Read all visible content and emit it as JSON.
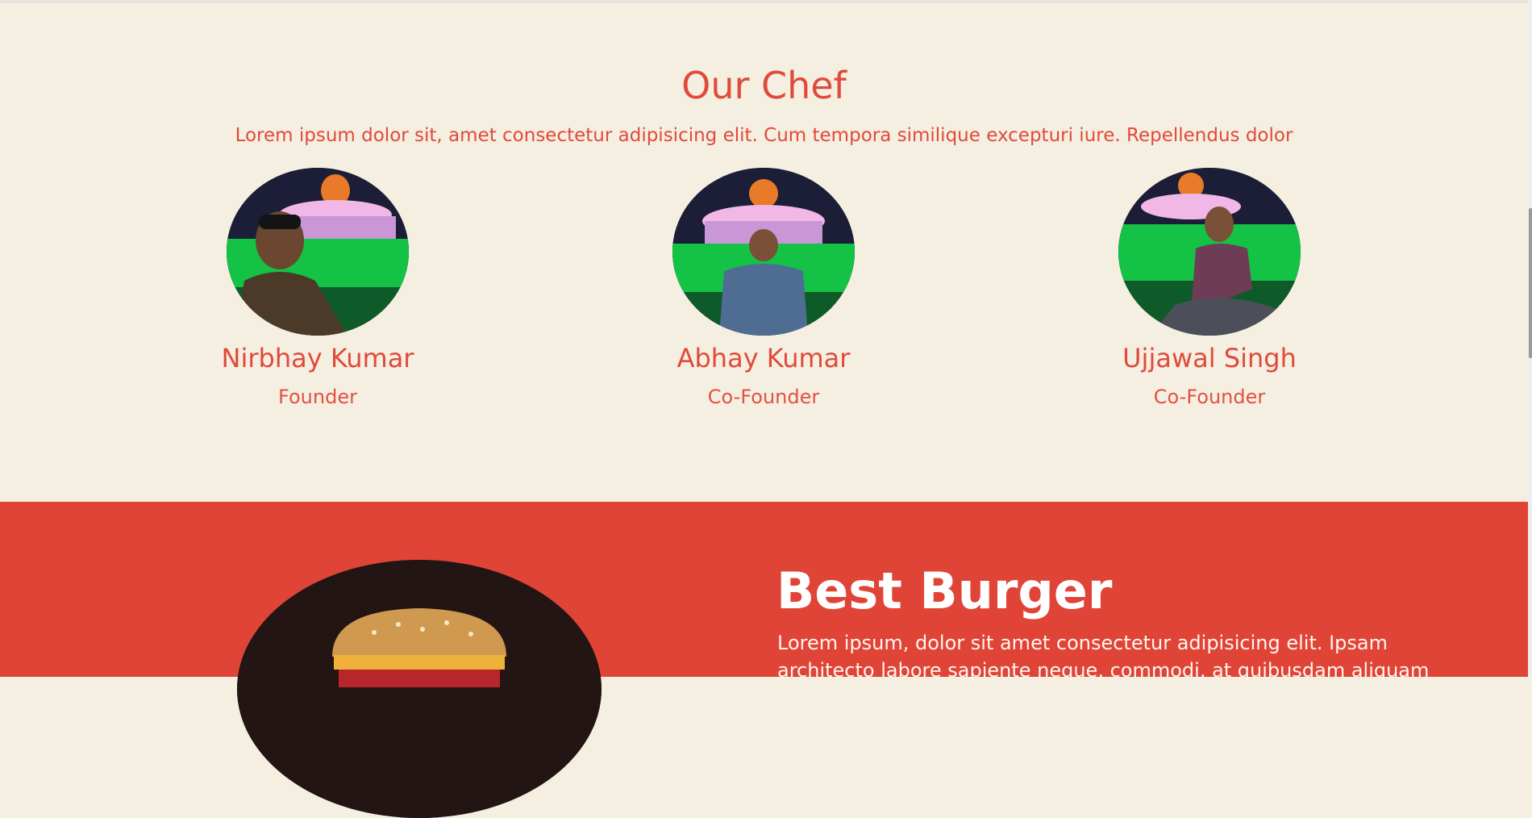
{
  "chef_section": {
    "title": "Our Chef",
    "subtitle": "Lorem ipsum dolor sit, amet consectetur adipisicing elit. Cum tempora similique excepturi iure. Repellendus dolor",
    "chefs": [
      {
        "name": "Nirbhay Kumar",
        "role": "Founder"
      },
      {
        "name": "Abhay Kumar",
        "role": "Co-Founder"
      },
      {
        "name": "Ujjawal Singh",
        "role": "Co-Founder"
      }
    ]
  },
  "burger_section": {
    "title": "Best Burger",
    "text": "Lorem ipsum, dolor sit amet consectetur adipisicing elit. Ipsam architecto labore sapiente neque, commodi, at quibusdam aliquam"
  },
  "colors": {
    "accent": "#e04a3a",
    "page_bg": "#f5efe1",
    "burger_bg": "#e04437"
  }
}
